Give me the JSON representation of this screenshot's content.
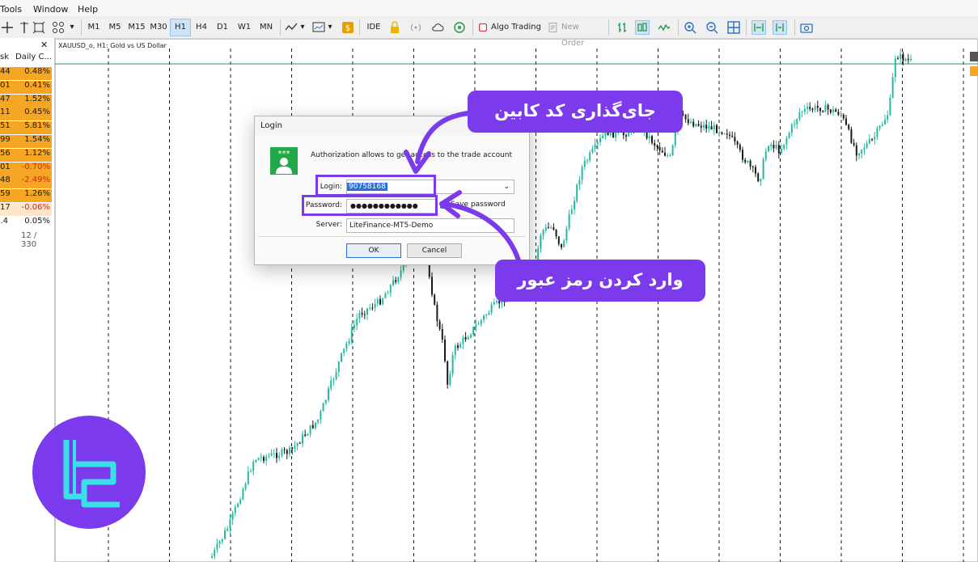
{
  "menu": [
    "Tools",
    "Window",
    "Help"
  ],
  "toolbar": {
    "timeframes": [
      "M1",
      "M5",
      "M15",
      "M30",
      "H1",
      "H4",
      "D1",
      "W1",
      "MN"
    ],
    "active_timeframe": "H1",
    "ide_label": "IDE",
    "algo_trading_label": "Algo Trading",
    "new_order_label": "New Order"
  },
  "market_watch": {
    "close_label": "✕",
    "col_ask": "sk",
    "col_change": "Daily C...",
    "rows": [
      {
        "bid": "44",
        "change": "0.48%",
        "color": "#f5a623"
      },
      {
        "bid": "01",
        "change": "0.41%",
        "color": "#f5a623"
      },
      {
        "bid": "47",
        "change": "1.52%",
        "color": "#f5a623"
      },
      {
        "bid": "11",
        "change": "0.45%",
        "color": "#f5a623"
      },
      {
        "bid": "51",
        "change": "5.81%",
        "color": "#f5a623"
      },
      {
        "bid": "99",
        "change": "1.54%",
        "color": "#f5a623"
      },
      {
        "bid": "56",
        "change": "1.12%",
        "color": "#f5a623"
      },
      {
        "bid": "01",
        "change": "-0.70%",
        "color": "#f5a623"
      },
      {
        "bid": "48",
        "change": "-2.49%",
        "color": "#f5a623"
      },
      {
        "bid": "59",
        "change": "1.26%",
        "color": "#f5a623"
      },
      {
        "bid": "17",
        "change": "-0.06%",
        "color": "#fde7c8"
      },
      {
        "bid": ".4",
        "change": "0.05%",
        "color": "#ffffff"
      }
    ],
    "count": "12 / 330"
  },
  "chart": {
    "title": "XAUUSD_o, H1:  Gold vs US Dollar"
  },
  "dialog": {
    "title": "Login",
    "info": "Authorization allows to get access to the trade account",
    "login_label": "Login:",
    "login_value": "90758168",
    "password_label": "Password:",
    "password_value": "●●●●●●●●●●●●",
    "save_label": "Save password",
    "server_label": "Server:",
    "server_value": "LiteFinance-MT5-Demo",
    "ok_label": "OK",
    "cancel_label": "Cancel"
  },
  "annotations": {
    "top_callout": "جای‌گذاری کد کابین",
    "bottom_callout": "وارد کردن رمز عبور"
  },
  "colors": {
    "accent": "#7c3aed",
    "bull": "#26b8a5",
    "bear": "#1a1a1a"
  }
}
